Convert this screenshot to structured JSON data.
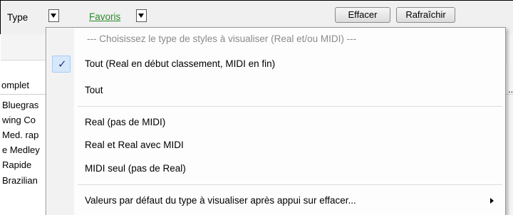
{
  "toolbar": {
    "type_label": "Type",
    "favoris_label": "Favoris",
    "effacer_label": "Effacer",
    "rafraichir_label": "Rafraîchir"
  },
  "grid": {
    "column_header": "omplet",
    "rows": [
      "Bluegras",
      "wing Co",
      "Med. rap",
      "e Medley",
      "Rapide",
      "Brazilian"
    ],
    "right_dots": ".."
  },
  "menu": {
    "header": "--- Choisissez le type de styles à visualiser (Real et/ou MIDI) ---",
    "items": [
      {
        "label": "Tout (Real en début classement, MIDI en fin)",
        "checked": true
      },
      {
        "label": "Tout",
        "checked": false
      },
      {
        "label": "Real (pas de MIDI)",
        "checked": false
      },
      {
        "label": "Real et Real avec MIDI",
        "checked": false
      },
      {
        "label": "MIDI seul (pas de Real)",
        "checked": false
      },
      {
        "label": "Valeurs par défaut du type à visualiser après appui sur effacer...",
        "checked": false,
        "submenu": true
      }
    ],
    "check_glyph": "✓"
  },
  "icons": {
    "dropdown": "dropdown-arrow-icon",
    "check": "check-icon",
    "submenu": "submenu-arrow-icon"
  },
  "colors": {
    "favoris": "#2a8a2a",
    "check_highlight": "#d6e8fa",
    "check": "#1e3f88"
  }
}
